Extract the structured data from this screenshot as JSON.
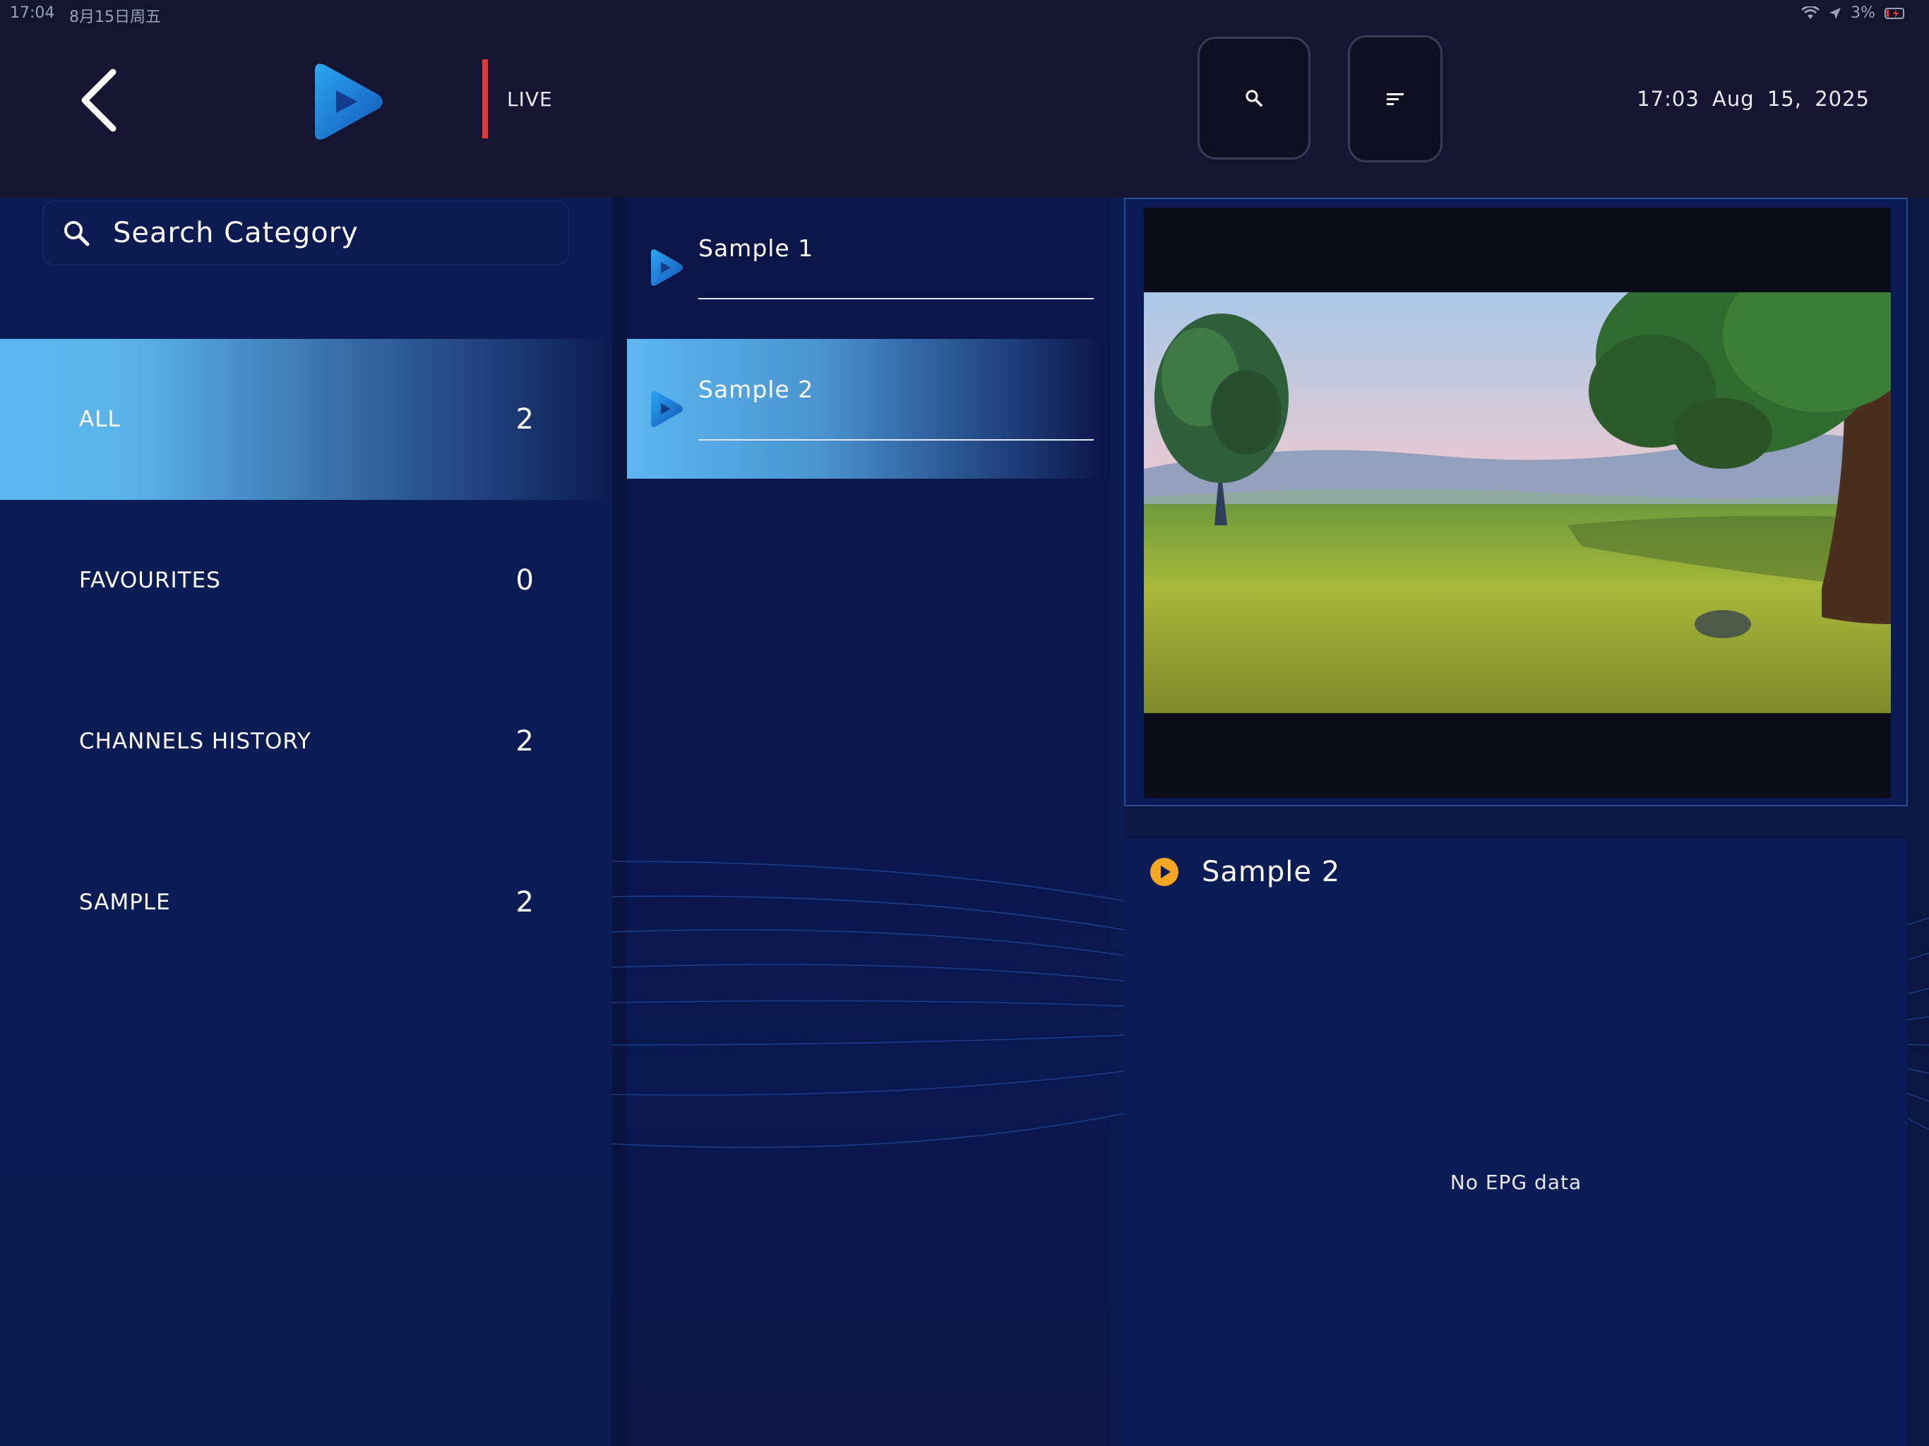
{
  "status_bar": {
    "time": "17:04",
    "date": "8月15日周五",
    "battery": "3%"
  },
  "header": {
    "section_label": "LIVE",
    "datetime": "17:03  Aug 15, 2025",
    "icons": {
      "back": "chevron-left-icon",
      "logo": "app-logo-play",
      "search": "search-icon",
      "sort": "sort-icon"
    }
  },
  "categories": {
    "search_placeholder": "Search Category",
    "items": [
      {
        "name": "ALL",
        "count": "2",
        "active": true
      },
      {
        "name": "FAVOURITES",
        "count": "0",
        "active": false
      },
      {
        "name": "CHANNELS HISTORY",
        "count": "2",
        "active": false
      },
      {
        "name": "SAMPLE",
        "count": "2",
        "active": false
      }
    ]
  },
  "channels": {
    "items": [
      {
        "name": "Sample 1",
        "active": false
      },
      {
        "name": "Sample 2",
        "active": true
      }
    ]
  },
  "now_playing": {
    "title": "Sample 2",
    "epg_empty_text": "No EPG data"
  },
  "colors": {
    "accent_active": "#5cb8ef",
    "live_bar": "#e53935",
    "play_icon": "#f5a623",
    "panel_bg": "#0b1c55",
    "header_bg": "#161531"
  }
}
